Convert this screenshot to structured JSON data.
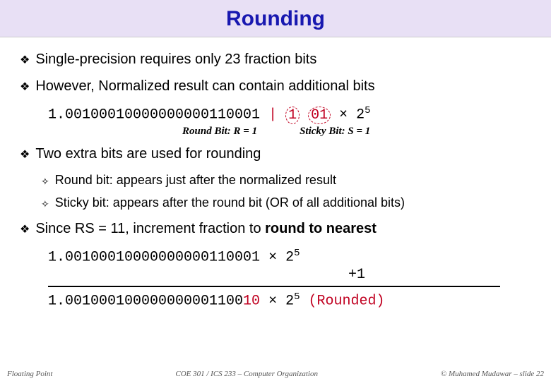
{
  "title": "Rounding",
  "bullets": {
    "b1": "Single-precision requires only 23 fraction bits",
    "b2": "However, Normalized result can contain additional bits",
    "b3": "Two extra bits are used for rounding",
    "b4_pre": "Since RS = 11, increment fraction to ",
    "b4_bold": "round to nearest"
  },
  "sub": {
    "s1_pre": "Round bit:",
    "s1_rest": " appears just after the normalized result",
    "s2_pre": "Sticky bit:",
    "s2_rest": " appears after the round bit (OR of all additional bits)"
  },
  "example": {
    "mantissa": "1.00100010000000000110001",
    "sep": " | ",
    "round_bit": "1",
    "space": " ",
    "sticky_bits": "01",
    "times": " × 2",
    "exp": "5",
    "round_label": "Round Bit: R = 1",
    "sticky_label": "Sticky Bit: S = 1"
  },
  "calc": {
    "line1_mantissa": "1.00100010000000000110001",
    "line1_mult": " × 2",
    "line1_exp": "5",
    "plus": "+1",
    "result_mantissa": "1.001000100000000001100",
    "result_last": "10",
    "result_mult": " × 2",
    "result_exp": "5",
    "rounded": " (Rounded)"
  },
  "footer": {
    "left": "Floating Point",
    "mid": "COE 301 / ICS 233 – Computer Organization",
    "right": "© Muhamed Mudawar – slide 22"
  }
}
